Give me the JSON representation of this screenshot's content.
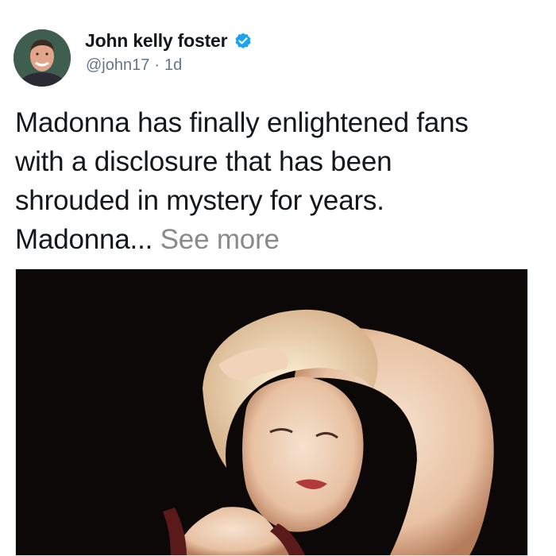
{
  "tweet": {
    "author": {
      "display_name": "John kelly foster",
      "handle": "@john17",
      "verified": true,
      "avatar_icon": "user-avatar"
    },
    "separator": "·",
    "timestamp": "1d",
    "text_lines": [
      "Madonna has finally enlightened fans",
      "with a disclosure that has been",
      "shrouded in mystery for years."
    ],
    "text_tail": "Madonna...",
    "see_more_label": "See more",
    "media": {
      "icon": "photo-image"
    }
  },
  "colors": {
    "verified_blue": "#1da1f2",
    "secondary_text": "#657786",
    "see_more": "#8a8a8a"
  }
}
